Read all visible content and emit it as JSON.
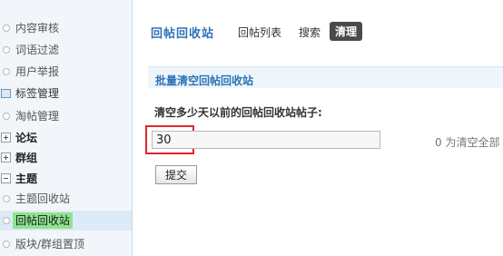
{
  "sidebar": {
    "items": [
      {
        "label": "内容审核"
      },
      {
        "label": "词语过滤"
      },
      {
        "label": "用户举报"
      },
      {
        "label": "标签管理"
      },
      {
        "label": "淘帖管理"
      },
      {
        "label": "论坛"
      },
      {
        "label": "群组"
      },
      {
        "label": "主题"
      },
      {
        "label": "主题回收站"
      },
      {
        "label": "回帖回收站"
      },
      {
        "label": "版块/群组置顶"
      }
    ]
  },
  "header": {
    "title": "回帖回收站",
    "tabs": [
      {
        "label": "回帖列表"
      },
      {
        "label": "搜索"
      },
      {
        "label": "清理"
      }
    ]
  },
  "form": {
    "section_title": "批量清空回帖回收站",
    "field_label": "清空多少天以前的回帖回收站帖子:",
    "days_value": "30",
    "hint": "0 为清空全部",
    "submit_label": "提交"
  }
}
